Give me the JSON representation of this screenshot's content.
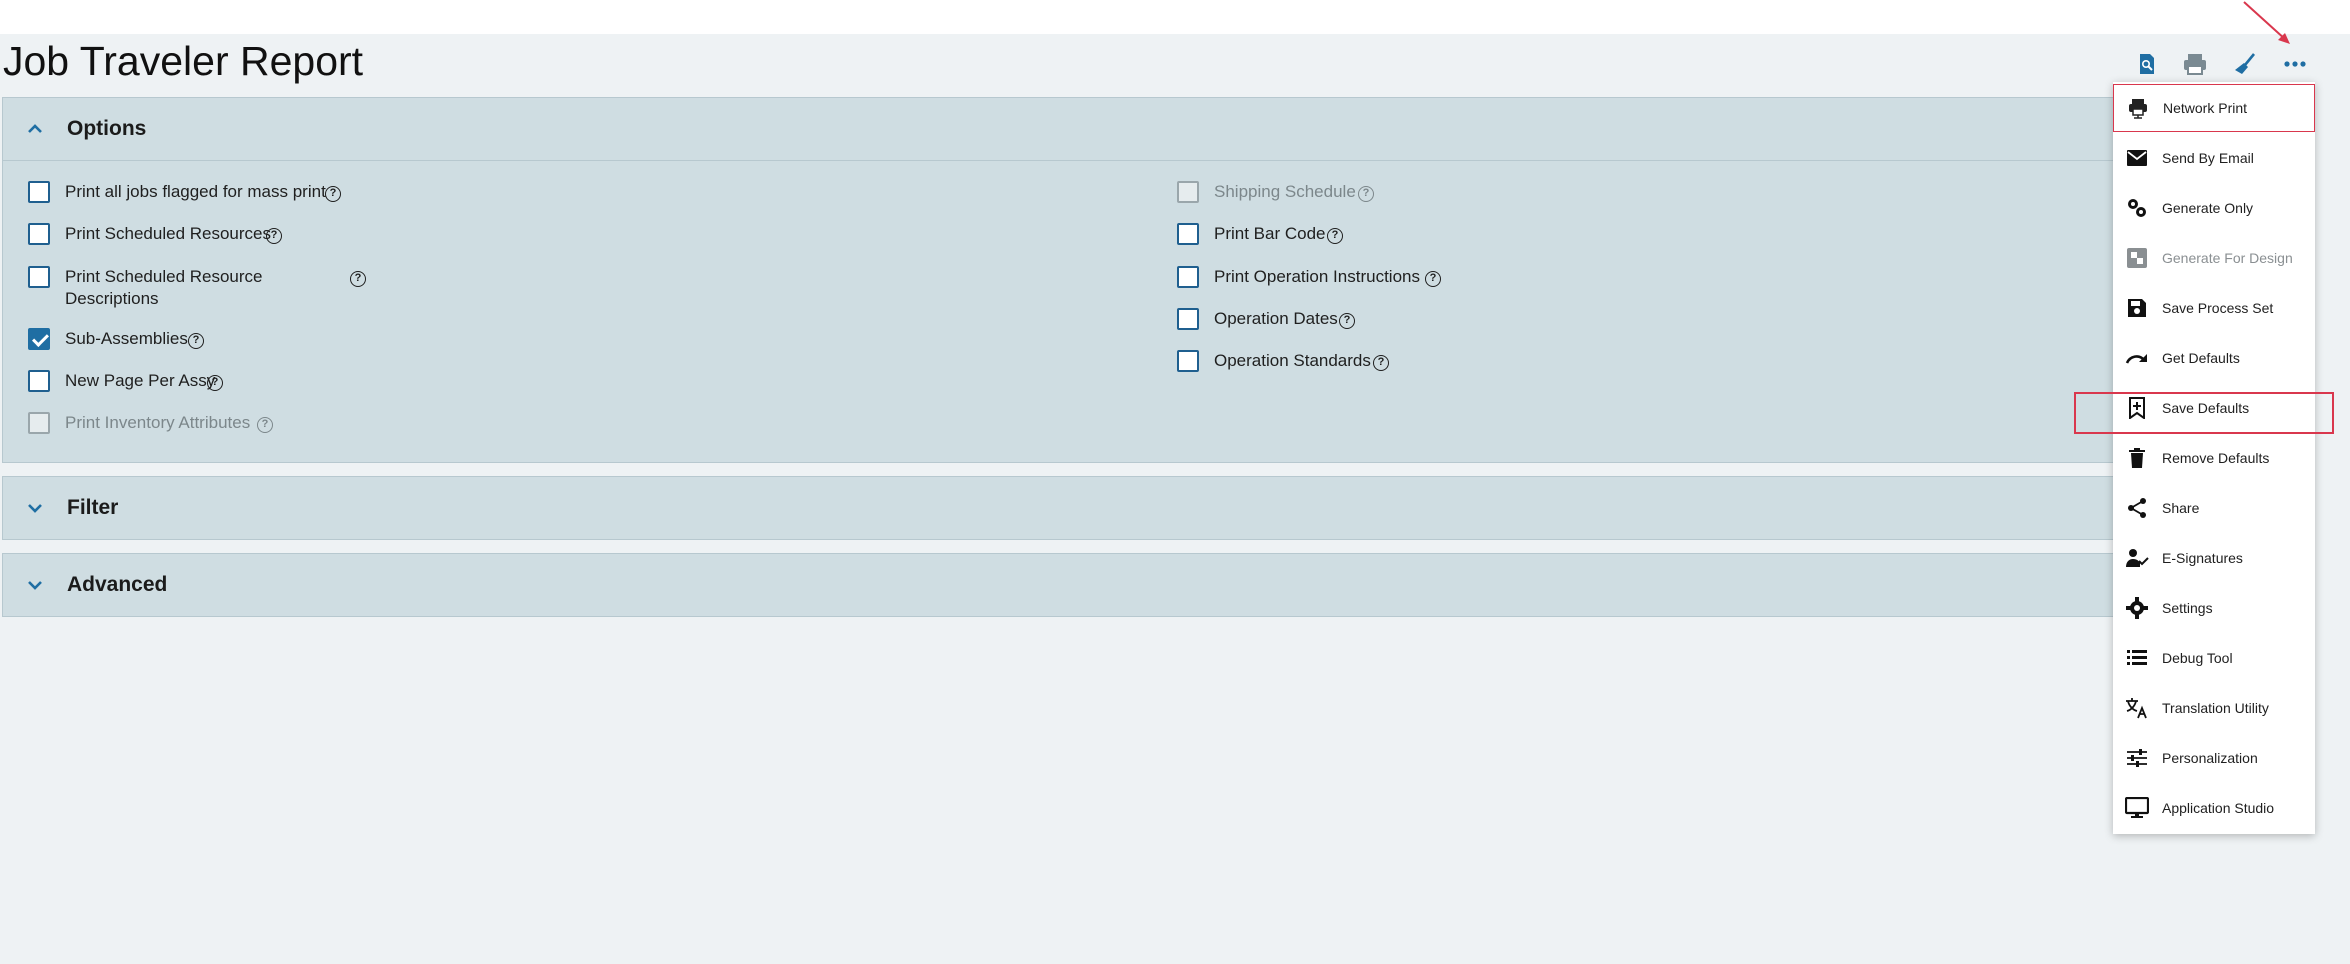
{
  "page": {
    "title": "Job Traveler Report"
  },
  "toolbar": {
    "icons": [
      "preview-icon",
      "print-icon",
      "clear-icon",
      "more-options-icon"
    ],
    "accent": "#1f6ea3"
  },
  "panels": {
    "options": {
      "label": "Options",
      "expanded": true
    },
    "filter": {
      "label": "Filter",
      "expanded": false
    },
    "advanced": {
      "label": "Advanced",
      "expanded": false
    }
  },
  "options": {
    "left": [
      {
        "label": "Print all jobs flagged for mass print",
        "checked": false,
        "disabled": false
      },
      {
        "label": "Print Scheduled Resources",
        "checked": false,
        "disabled": false
      },
      {
        "label": "Print Scheduled Resource Descriptions",
        "checked": false,
        "disabled": false
      },
      {
        "label": "Sub-Assemblies",
        "checked": true,
        "disabled": false
      },
      {
        "label": "New Page Per Assy",
        "checked": false,
        "disabled": false
      },
      {
        "label": "Print Inventory Attributes",
        "checked": false,
        "disabled": true
      }
    ],
    "right": [
      {
        "label": "Shipping Schedule",
        "checked": false,
        "disabled": true
      },
      {
        "label": "Print Bar Code",
        "checked": false,
        "disabled": false
      },
      {
        "label": "Print Operation Instructions",
        "checked": false,
        "disabled": false
      },
      {
        "label": "Operation Dates",
        "checked": false,
        "disabled": false
      },
      {
        "label": "Operation Standards",
        "checked": false,
        "disabled": false
      }
    ]
  },
  "menu": {
    "items": [
      {
        "label": "Network Print",
        "icon": "network-print-icon",
        "disabled": false
      },
      {
        "label": "Send By Email",
        "icon": "email-icon",
        "disabled": false
      },
      {
        "label": "Generate Only",
        "icon": "gears-icon",
        "disabled": false
      },
      {
        "label": "Generate For Design",
        "icon": "design-icon",
        "disabled": true
      },
      {
        "label": "Save Process Set",
        "icon": "save-icon",
        "disabled": false
      },
      {
        "label": "Get Defaults",
        "icon": "redo-icon",
        "disabled": false
      },
      {
        "label": "Save Defaults",
        "icon": "bookmark-add-icon",
        "disabled": false
      },
      {
        "label": "Remove Defaults",
        "icon": "trash-icon",
        "disabled": false
      },
      {
        "label": "Share",
        "icon": "share-icon",
        "disabled": false
      },
      {
        "label": "E-Signatures",
        "icon": "signature-icon",
        "disabled": false
      },
      {
        "label": "Settings",
        "icon": "gear-icon",
        "disabled": false
      },
      {
        "label": "Debug Tool",
        "icon": "list-icon",
        "disabled": false
      },
      {
        "label": "Translation Utility",
        "icon": "translate-icon",
        "disabled": false
      },
      {
        "label": "Personalization",
        "icon": "sliders-icon",
        "disabled": false
      },
      {
        "label": "Application Studio",
        "icon": "monitor-icon",
        "disabled": false
      }
    ]
  },
  "annotation_color": "#d9374d"
}
